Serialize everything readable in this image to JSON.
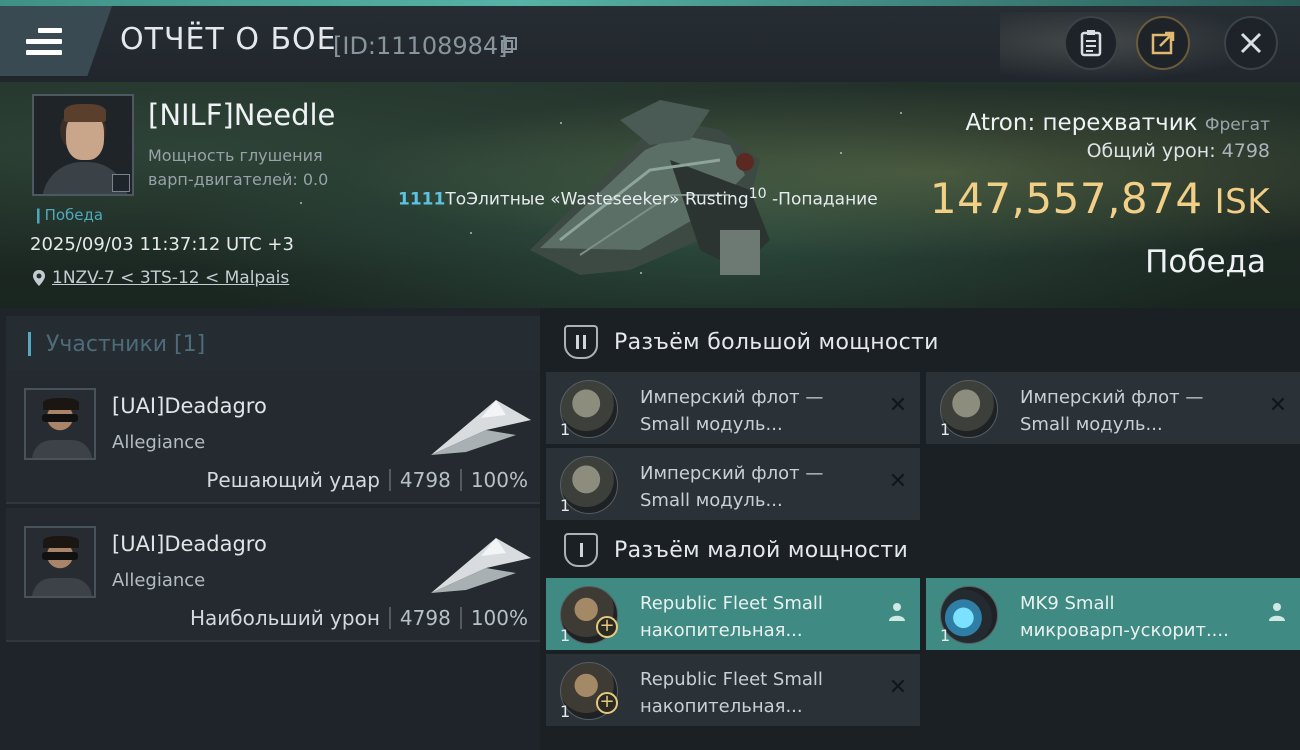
{
  "header": {
    "title": "ОТЧЁТ О БОЕ",
    "report_id": "[ID:11108984]",
    "icons": [
      "menu-icon",
      "copy-icon",
      "clipboard-icon",
      "share-icon",
      "close-icon"
    ]
  },
  "victim": {
    "name": "[NILF]Needle",
    "warp_label_line1": "Мощность глушения",
    "warp_label_line2": "варп-двигателей: 0.0",
    "victory_tag": "Победа",
    "datetime": "2025/09/03 11:37:12 UTC +3",
    "location": "1NZV-7 < 3TS-12 < Malpais",
    "damage_number": "1111",
    "damage_text": "ТоЭлитные «Wasteseeker» Rusting",
    "damage_sup": "10",
    "damage_result": " -Попадание",
    "ship_name": "Atron: перехватчик",
    "ship_class": "Фрегат",
    "total_damage_label": "Общий урон:",
    "total_damage_value": "4798",
    "isk_value": "147,557,874",
    "isk_unit": "ISK",
    "result": "Победа"
  },
  "participants": {
    "header": "Участники [1]",
    "rows": [
      {
        "name": "[UAI]Deadagro",
        "alliance": "Allegiance",
        "role": "Решающий удар",
        "damage": "4798",
        "percent": "100%"
      },
      {
        "name": "[UAI]Deadagro",
        "alliance": "Allegiance",
        "role": "Наибольший урон",
        "damage": "4798",
        "percent": "100%"
      }
    ]
  },
  "slots": {
    "high": {
      "title": "Разъём большой мощности",
      "modules": [
        {
          "line1": "Имперский флот —",
          "line2": "Small модуль...",
          "qty": "1"
        },
        {
          "line1": "Имперский флот —",
          "line2": "Small модуль...",
          "qty": "1"
        },
        {
          "line1": "Имперский флот —",
          "line2": "Small модуль...",
          "qty": "1"
        }
      ]
    },
    "low": {
      "title": "Разъём малой мощности",
      "modules": [
        {
          "line1": "Republic Fleet Small",
          "line2": "накопительная...",
          "qty": "1"
        },
        {
          "line1": "MK9 Small",
          "line2": "микроварп-ускорит....",
          "qty": "1"
        },
        {
          "line1": "Republic Fleet Small",
          "line2": "накопительная...",
          "qty": "1"
        }
      ]
    }
  },
  "colors": {
    "accent_teal": "#3f8a82",
    "isk_gold": "#f1cf86",
    "highlight_blue": "#5ec2e0"
  }
}
